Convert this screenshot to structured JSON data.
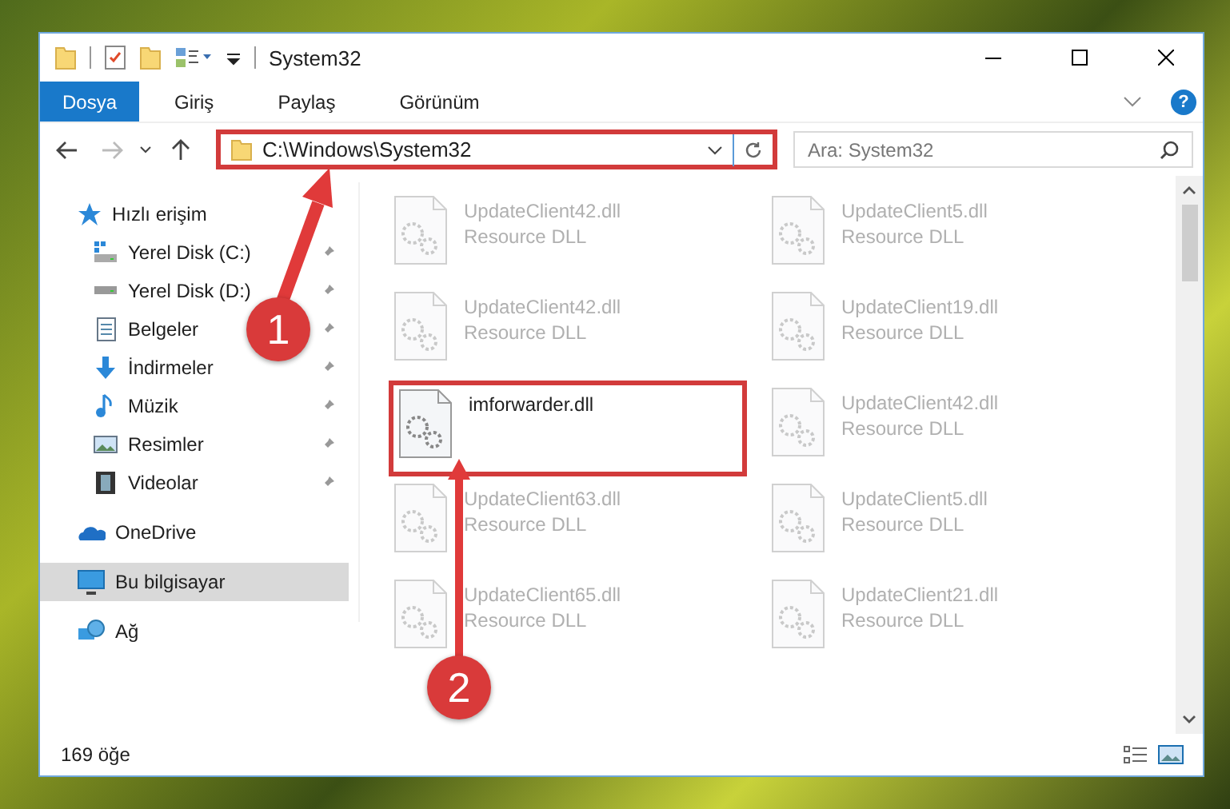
{
  "window": {
    "title": "System32"
  },
  "ribbon_tabs": [
    {
      "label": "Dosya",
      "selected": true
    },
    {
      "label": "Giriş",
      "selected": false
    },
    {
      "label": "Paylaş",
      "selected": false
    },
    {
      "label": "Görünüm",
      "selected": false
    }
  ],
  "help": "?",
  "address": {
    "value": "C:\\Windows\\System32",
    "highlighted": true
  },
  "search": {
    "placeholder": "Ara: System32"
  },
  "sidebar": {
    "items": [
      {
        "label": "Hızlı erişim",
        "kind": "star",
        "selected": false,
        "children": [
          {
            "label": "Yerel Disk (C:)",
            "kind": "system-drive",
            "pinned": true,
            "selected": false
          },
          {
            "label": "Yerel Disk (D:)",
            "kind": "drive",
            "pinned": true,
            "selected": false
          },
          {
            "label": "Belgeler",
            "kind": "document",
            "pinned": true,
            "selected": false
          },
          {
            "label": "İndirmeler",
            "kind": "download",
            "pinned": true,
            "selected": false
          },
          {
            "label": "Müzik",
            "kind": "music",
            "pinned": true,
            "selected": false
          },
          {
            "label": "Resimler",
            "kind": "picture",
            "pinned": true,
            "selected": false
          },
          {
            "label": "Videolar",
            "kind": "video",
            "pinned": true,
            "selected": false
          }
        ]
      },
      {
        "label": "OneDrive",
        "kind": "cloud",
        "selected": false
      },
      {
        "label": "Bu bilgisayar",
        "kind": "computer",
        "selected": true
      },
      {
        "label": "Ağ",
        "kind": "network",
        "selected": false
      }
    ]
  },
  "files": [
    {
      "name": "UpdateClient42.dll",
      "type": "Resource DLL",
      "dimmed": true,
      "highlighted": false
    },
    {
      "name": "UpdateClient5.dll",
      "type": "Resource DLL",
      "dimmed": true,
      "highlighted": false
    },
    {
      "name": "UpdateClient42.dll",
      "type": "Resource DLL",
      "dimmed": true,
      "highlighted": false
    },
    {
      "name": "UpdateClient19.dll",
      "type": "Resource DLL",
      "dimmed": true,
      "highlighted": false
    },
    {
      "name": "imforwarder.dll",
      "dimmed": false,
      "highlighted": true
    },
    {
      "name": "UpdateClient42.dll",
      "type": "Resource DLL",
      "dimmed": true,
      "highlighted": false
    },
    {
      "name": "UpdateClient63.dll",
      "type": "Resource DLL",
      "dimmed": true,
      "highlighted": false
    },
    {
      "name": "UpdateClient5.dll",
      "type": "Resource DLL",
      "dimmed": true,
      "highlighted": false
    },
    {
      "name": "UpdateClient65.dll",
      "type": "Resource DLL",
      "dimmed": true,
      "highlighted": false
    },
    {
      "name": "UpdateClient21.dll",
      "type": "Resource DLL",
      "dimmed": true,
      "highlighted": false
    }
  ],
  "status_bar": {
    "item_count": "169 öğe"
  },
  "callouts": [
    {
      "label": "1"
    },
    {
      "label": "2"
    }
  ]
}
